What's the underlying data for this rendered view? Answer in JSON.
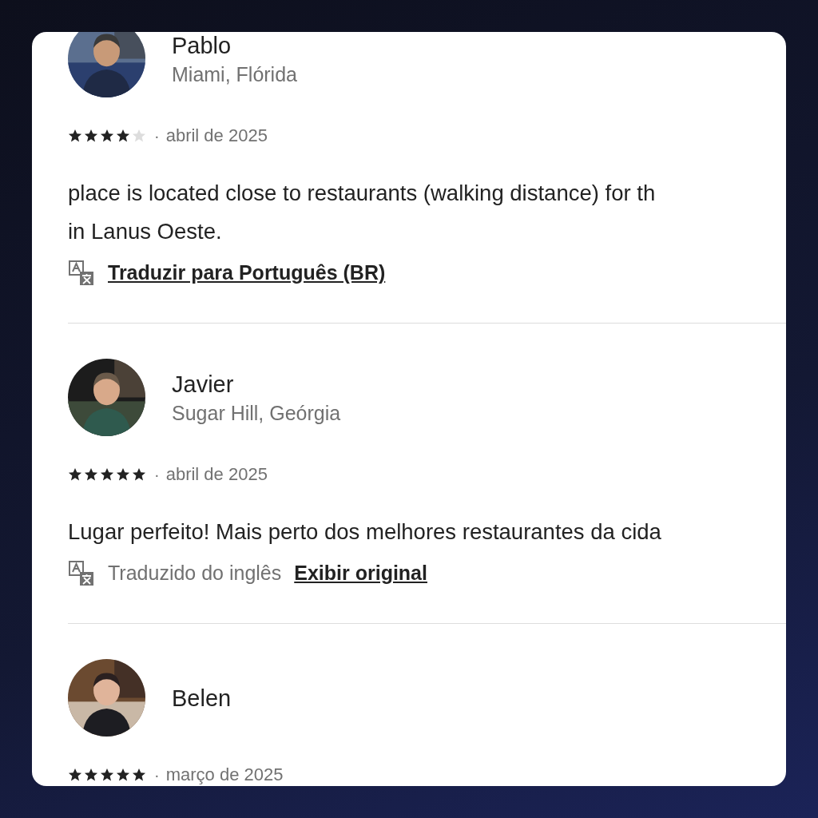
{
  "reviews": [
    {
      "name": "Pablo",
      "location": "Miami, Flórida",
      "stars": 4,
      "separator": "·",
      "date": "abril de 2025",
      "body_lines": [
        "place is located close to restaurants (walking distance) for th",
        "in Lanus Oeste."
      ],
      "translation": {
        "kind": "offer",
        "link": "Traduzir para Português (BR)"
      }
    },
    {
      "name": "Javier",
      "location": "Sugar Hill, Geórgia",
      "stars": 5,
      "separator": "·",
      "date": "abril de 2025",
      "body_lines": [
        "Lugar perfeito! Mais perto dos melhores restaurantes da cida"
      ],
      "translation": {
        "kind": "translated",
        "note": "Traduzido do inglês",
        "link": "Exibir original"
      }
    },
    {
      "name": "Belen",
      "stars": 5,
      "separator": "·",
      "date": "março de 2025"
    }
  ]
}
